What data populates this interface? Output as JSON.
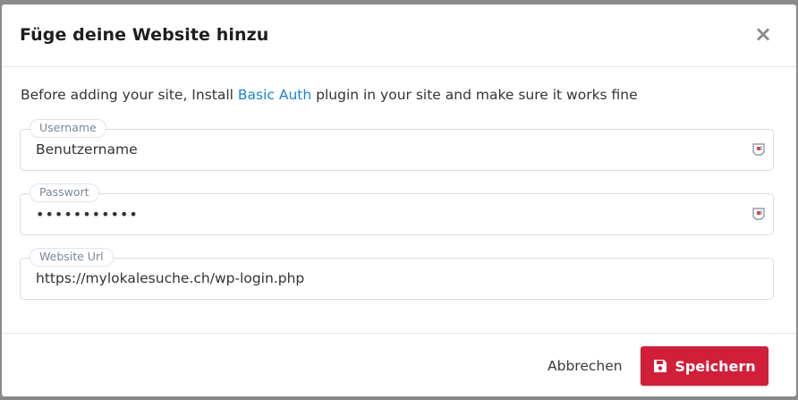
{
  "modal": {
    "title": "Füge deine Website hinzu",
    "close_glyph": "×"
  },
  "intro": {
    "before": "Before adding your site, Install ",
    "link": "Basic Auth",
    "after": " plugin in your site and make sure it works fine"
  },
  "fields": {
    "username": {
      "label": "Username",
      "value": "Benutzername"
    },
    "password": {
      "label": "Passwort",
      "value": "•••••••••••"
    },
    "website_url": {
      "label": "Website Url",
      "value": "https://mylokalesuche.ch/wp-login.php"
    }
  },
  "footer": {
    "cancel_label": "Abbrechen",
    "save_label": "Speichern"
  },
  "colors": {
    "accent": "#d11f3a",
    "link": "#1a82d6"
  },
  "icons": {
    "close": "close-icon",
    "autofill": "autofill-icon",
    "save": "floppy-disk-icon"
  }
}
